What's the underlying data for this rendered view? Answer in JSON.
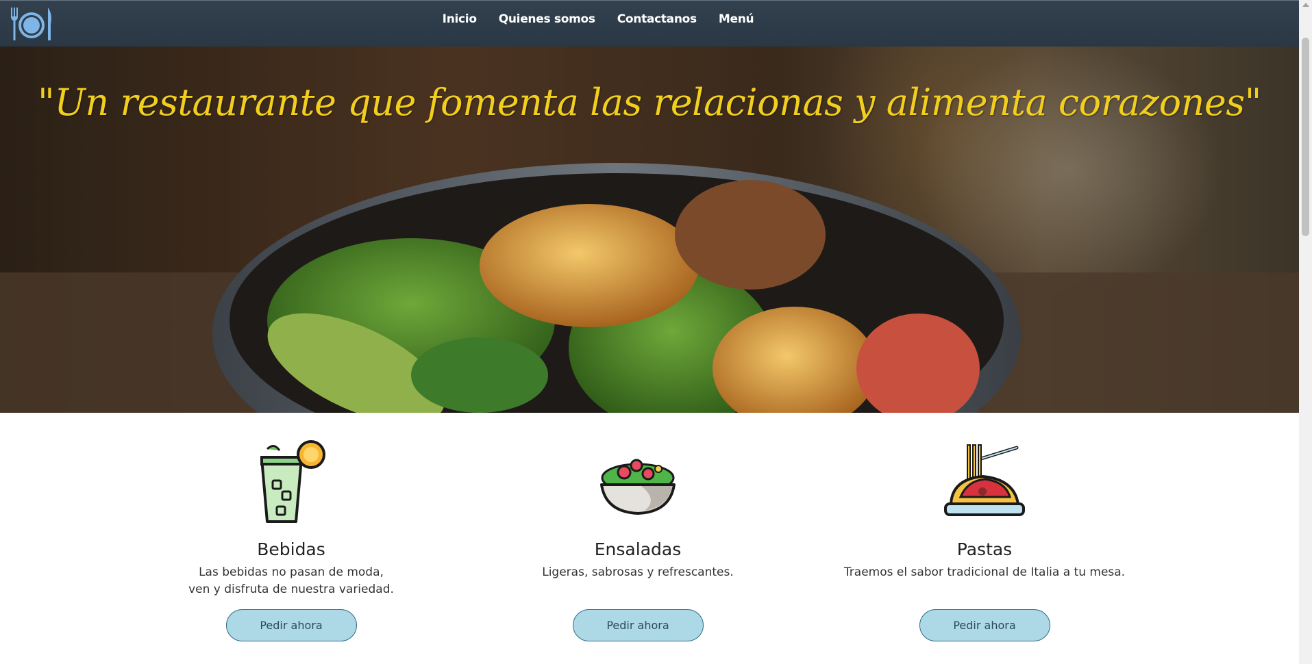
{
  "nav": {
    "logo": "plate-cutlery-logo",
    "links": [
      "Inicio",
      "Quienes somos",
      "Contactanos",
      "Menú"
    ]
  },
  "hero": {
    "quote": "\"Un restaurante que fomenta las relacionas y alimenta corazones\"",
    "image": "salad-bowl-photo"
  },
  "cards": [
    {
      "title": "Bebidas",
      "description": "Las bebidas no pasan de moda,\nven y disfruta de nuestra variedad.",
      "button": "Pedir ahora",
      "icon": "drink-glass-icon"
    },
    {
      "title": "Ensaladas",
      "description": "Ligeras, sabrosas y refrescantes.",
      "button": "Pedir ahora",
      "icon": "salad-bowl-icon"
    },
    {
      "title": "Pastas",
      "description": "Traemos el sabor tradicional de Italia a tu mesa.",
      "button": "Pedir ahora",
      "icon": "pasta-plate-icon"
    }
  ],
  "colors": {
    "navbar": "#2f3c4a",
    "quote": "#f2cf1d",
    "button_fill": "#add8e6",
    "button_border": "#2e6b85"
  }
}
